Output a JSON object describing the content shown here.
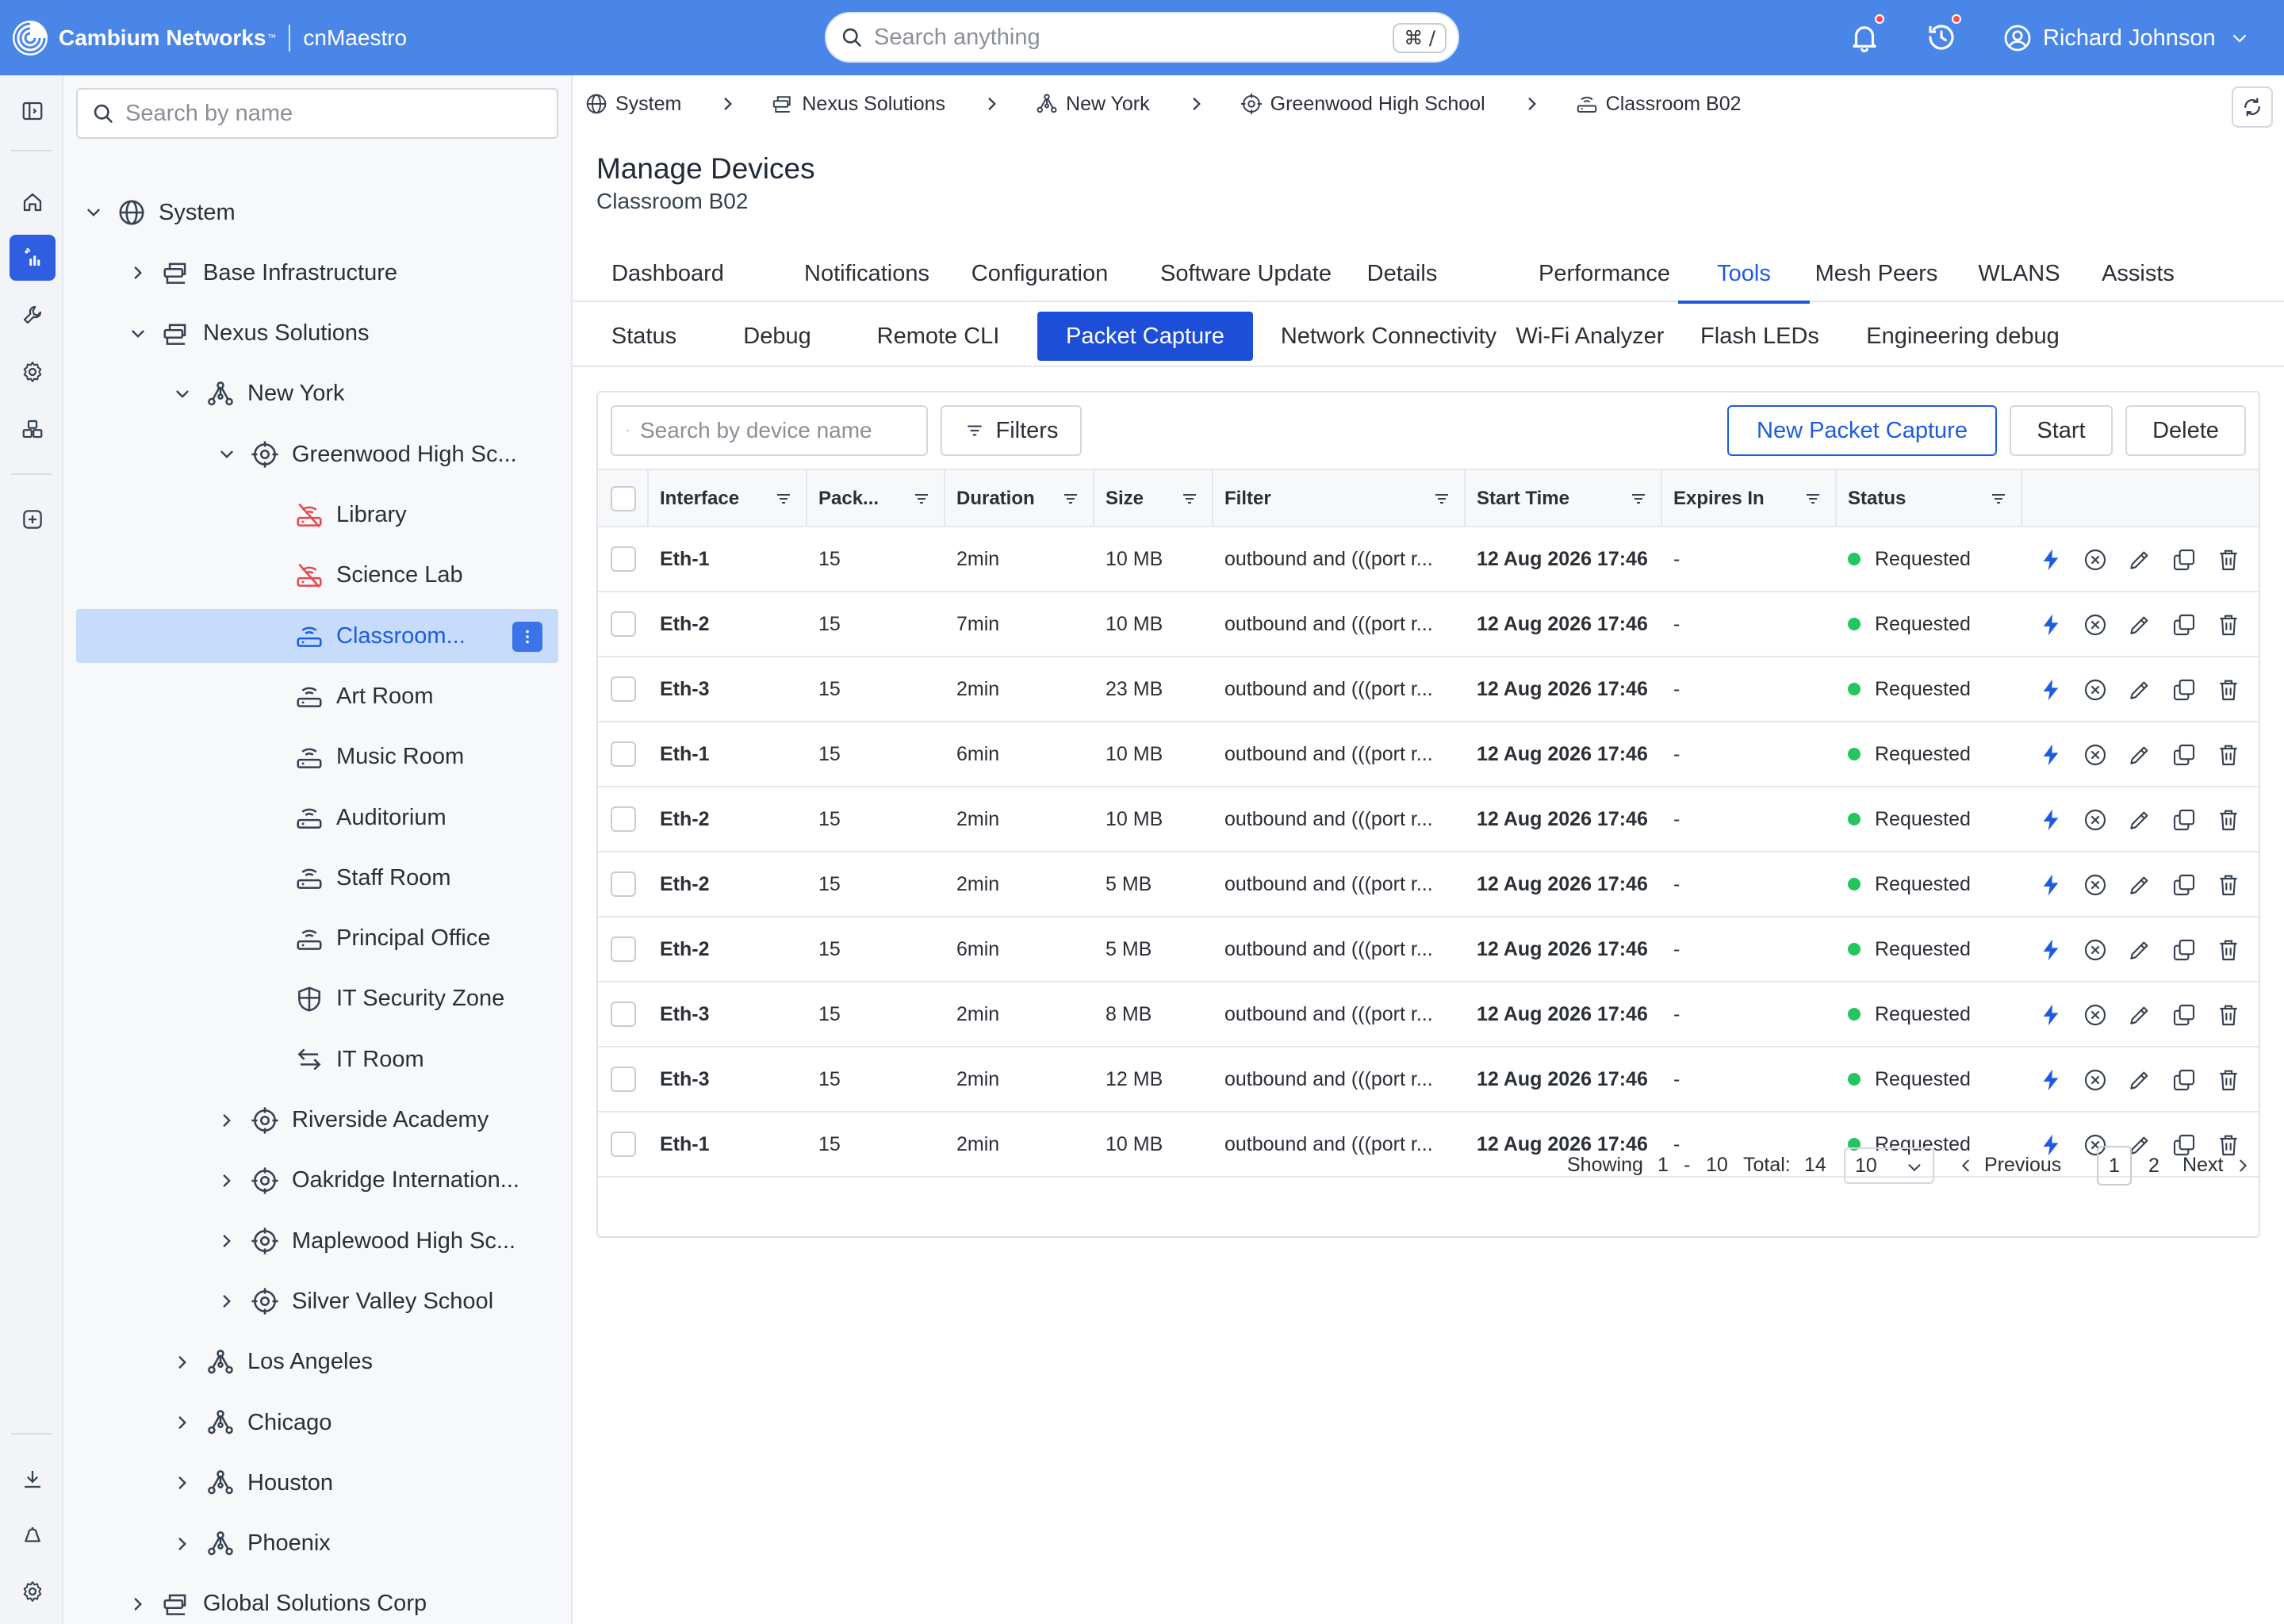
{
  "header": {
    "company": "Cambium Networks",
    "trademark": "™",
    "product": "cnMaestro",
    "search_placeholder": "Search anything",
    "shortcut": "⌘ /",
    "user_name": "Richard Johnson"
  },
  "tree": {
    "search_placeholder": "Search by name",
    "items": [
      {
        "label": "System",
        "level": 0,
        "expanded": true,
        "icon": "globe-icon"
      },
      {
        "label": "Base Infrastructure",
        "level": 1,
        "expanded": false,
        "icon": "organization-icon"
      },
      {
        "label": "Nexus Solutions",
        "level": 1,
        "expanded": true,
        "icon": "organization-icon"
      },
      {
        "label": "New York",
        "level": 2,
        "expanded": true,
        "icon": "network-icon"
      },
      {
        "label": "Greenwood High Sc...",
        "level": 3,
        "expanded": true,
        "icon": "site-icon"
      },
      {
        "label": "Library",
        "level": 4,
        "icon": "router-offline-icon"
      },
      {
        "label": "Science Lab",
        "level": 4,
        "icon": "router-offline-icon"
      },
      {
        "label": "Classroom...",
        "level": 4,
        "icon": "router-icon",
        "selected": true
      },
      {
        "label": "Art Room",
        "level": 4,
        "icon": "router-icon"
      },
      {
        "label": "Music Room",
        "level": 4,
        "icon": "router-icon"
      },
      {
        "label": "Auditorium",
        "level": 4,
        "icon": "router-icon"
      },
      {
        "label": "Staff Room",
        "level": 4,
        "icon": "router-icon"
      },
      {
        "label": "Principal Office",
        "level": 4,
        "icon": "router-icon"
      },
      {
        "label": "IT Security Zone",
        "level": 4,
        "icon": "shield-icon"
      },
      {
        "label": "IT Room",
        "level": 4,
        "icon": "switch-icon"
      },
      {
        "label": "Riverside Academy",
        "level": 3,
        "expanded": false,
        "icon": "site-icon"
      },
      {
        "label": "Oakridge Internation...",
        "level": 3,
        "expanded": false,
        "icon": "site-icon"
      },
      {
        "label": "Maplewood High Sc...",
        "level": 3,
        "expanded": false,
        "icon": "site-icon"
      },
      {
        "label": "Silver Valley School",
        "level": 3,
        "expanded": false,
        "icon": "site-icon"
      },
      {
        "label": "Los Angeles",
        "level": 2,
        "expanded": false,
        "icon": "network-icon"
      },
      {
        "label": "Chicago",
        "level": 2,
        "expanded": false,
        "icon": "network-icon"
      },
      {
        "label": "Houston",
        "level": 2,
        "expanded": false,
        "icon": "network-icon"
      },
      {
        "label": "Phoenix",
        "level": 2,
        "expanded": false,
        "icon": "network-icon"
      },
      {
        "label": "Global Solutions Corp",
        "level": 1,
        "expanded": false,
        "icon": "organization-icon"
      }
    ]
  },
  "breadcrumb": [
    {
      "label": "System",
      "icon": "globe-icon"
    },
    {
      "label": "Nexus Solutions",
      "icon": "organization-icon"
    },
    {
      "label": "New York",
      "icon": "network-icon"
    },
    {
      "label": "Greenwood High School",
      "icon": "site-icon"
    },
    {
      "label": "Classroom B02",
      "icon": "router-icon"
    }
  ],
  "page": {
    "title": "Manage Devices",
    "subtitle": "Classroom B02"
  },
  "tabs": [
    "Dashboard",
    "Notifications",
    "Configuration",
    "Software Update",
    "Details",
    "Performance",
    "Tools",
    "Mesh Peers",
    "WLANS",
    "Assists"
  ],
  "active_tab": "Tools",
  "subtabs": [
    "Status",
    "Debug",
    "Remote CLI",
    "Packet Capture",
    "Network Connectivity",
    "Wi-Fi Analyzer",
    "Flash LEDs",
    "Engineering debug"
  ],
  "active_subtab": "Packet Capture",
  "toolbar": {
    "search_placeholder": "Search by device name",
    "filters_label": "Filters",
    "new_label": "New Packet Capture",
    "start_label": "Start",
    "delete_label": "Delete"
  },
  "table": {
    "columns": [
      "Interface",
      "Pack...",
      "Duration",
      "Size",
      "Filter",
      "Start Time",
      "Expires In",
      "Status"
    ],
    "rows": [
      [
        "Eth-1",
        "15",
        "2min",
        "10 MB",
        "outbound and (((port r...",
        "12 Aug 2026 17:46",
        "-",
        "Requested"
      ],
      [
        "Eth-2",
        "15",
        "7min",
        "10 MB",
        "outbound and (((port r...",
        "12 Aug 2026 17:46",
        "-",
        "Requested"
      ],
      [
        "Eth-3",
        "15",
        "2min",
        "23 MB",
        "outbound and (((port r...",
        "12 Aug 2026 17:46",
        "-",
        "Requested"
      ],
      [
        "Eth-1",
        "15",
        "6min",
        "10 MB",
        "outbound and (((port r...",
        "12 Aug 2026 17:46",
        "-",
        "Requested"
      ],
      [
        "Eth-2",
        "15",
        "2min",
        "10 MB",
        "outbound and (((port r...",
        "12 Aug 2026 17:46",
        "-",
        "Requested"
      ],
      [
        "Eth-2",
        "15",
        "2min",
        "5 MB",
        "outbound and (((port r...",
        "12 Aug 2026 17:46",
        "-",
        "Requested"
      ],
      [
        "Eth-2",
        "15",
        "6min",
        "5 MB",
        "outbound and (((port r...",
        "12 Aug 2026 17:46",
        "-",
        "Requested"
      ],
      [
        "Eth-3",
        "15",
        "2min",
        "8 MB",
        "outbound and (((port r...",
        "12 Aug 2026 17:46",
        "-",
        "Requested"
      ],
      [
        "Eth-3",
        "15",
        "2min",
        "12 MB",
        "outbound and (((port r...",
        "12 Aug 2026 17:46",
        "-",
        "Requested"
      ],
      [
        "Eth-1",
        "15",
        "2min",
        "10 MB",
        "outbound and (((port r...",
        "12 Aug 2026 17:46",
        "-",
        "Requested"
      ]
    ],
    "row_actions": [
      "bolt-icon",
      "cancel-circle-icon",
      "pencil-icon",
      "copy-icon",
      "trash-icon"
    ]
  },
  "pagination": {
    "showing_label": "Showing",
    "from": "1",
    "dash": "-",
    "to": "10",
    "total_label": "Total:",
    "total": "14",
    "page_size": "10",
    "previous_label": "Previous",
    "pages": [
      "1",
      "2"
    ],
    "current_page": "1",
    "next_label": "Next"
  },
  "colors": {
    "header_bg": "#4a86e8",
    "accent": "#1d5be0",
    "active_subtab": "#1d4ed8",
    "status_requested": "#22c55e",
    "offline": "#e5484d"
  }
}
